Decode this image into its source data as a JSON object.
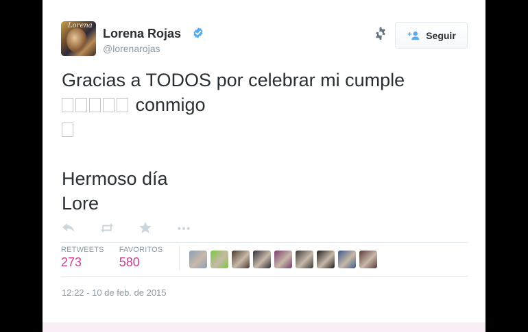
{
  "user": {
    "name": "Lorena Rojas",
    "handle": "@lorenarojas",
    "avatar_text": "Lorena"
  },
  "follow_button": {
    "label": "Seguir"
  },
  "tweet": {
    "lines": [
      "Gracias a TODOS por celebrar mi cumple",
      "conmigo",
      "",
      "",
      "Hermoso día",
      "Lore"
    ]
  },
  "stats": {
    "retweets_label": "RETWEETS",
    "retweets_value": "273",
    "favorites_label": "FAVORITOS",
    "favorites_value": "580"
  },
  "favoriters": [
    {
      "color": "#8aa0b8"
    },
    {
      "color": "#7ac943"
    },
    {
      "color": "#4a3a2e"
    },
    {
      "color": "#2e2e3a"
    },
    {
      "color": "#7a3a6e"
    },
    {
      "color": "#3a3a3a"
    },
    {
      "color": "#1e1e1e"
    },
    {
      "color": "#3a5a8a"
    },
    {
      "color": "#5a3a3a"
    }
  ],
  "timestamp": "12:22 - 10 de feb. de 2015",
  "colors": {
    "accent_pink": "#cc3c93",
    "verified_blue": "#55acee",
    "muted": "#8899a6"
  }
}
